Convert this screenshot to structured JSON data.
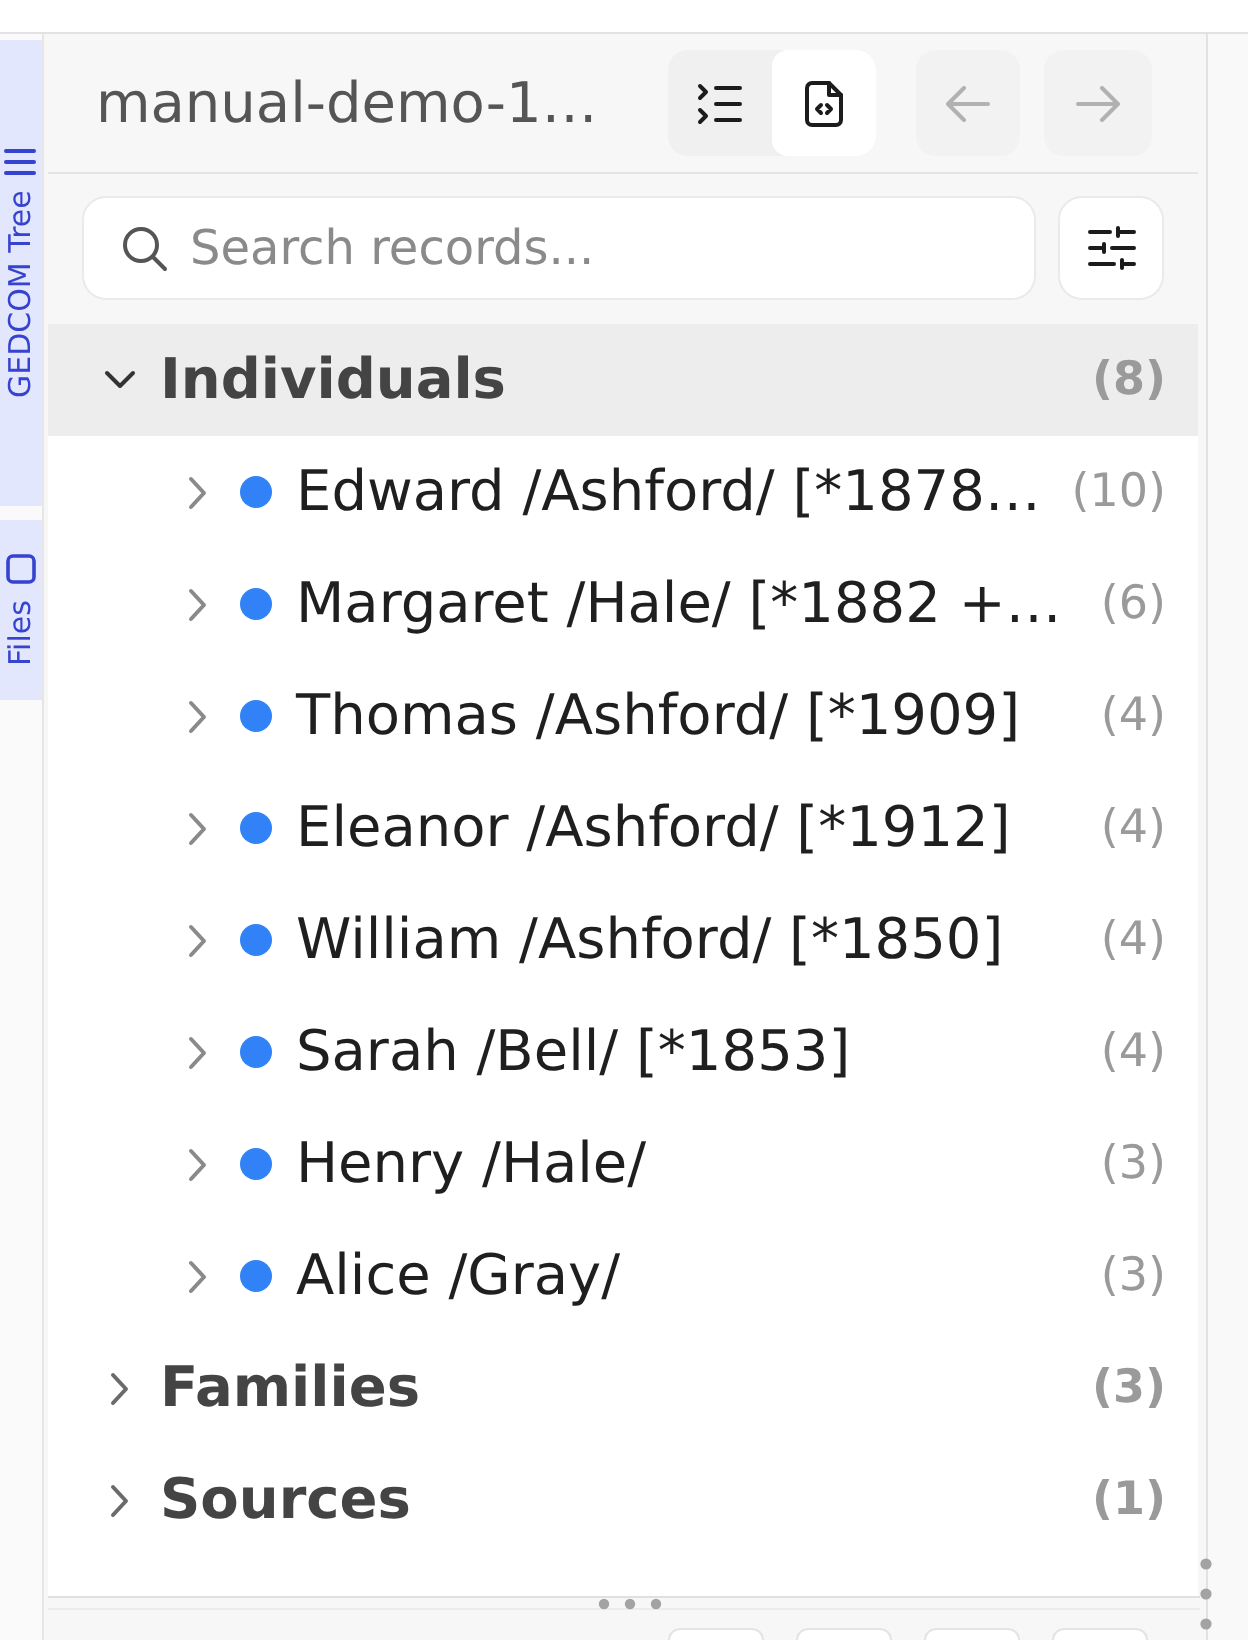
{
  "side_tabs": [
    {
      "kind": "tree",
      "label": "GEDCOM Tree"
    },
    {
      "kind": "files",
      "label": "Files"
    }
  ],
  "header": {
    "title": "manual-demo-1…",
    "view_toggle": [
      {
        "kind": "outline",
        "selected": false
      },
      {
        "kind": "source",
        "selected": true
      }
    ],
    "nav_buttons": [
      {
        "kind": "back",
        "disabled": true
      },
      {
        "kind": "forward",
        "disabled": true
      }
    ]
  },
  "search": {
    "placeholder": "Search records..."
  },
  "tree": [
    {
      "label": "Individuals",
      "count": "(8)",
      "expanded": true,
      "selected": true,
      "children": [
        {
          "label": "Edward /Ashford/ [*1878…",
          "count": "(10)",
          "expanded": false,
          "selected": false
        },
        {
          "label": "Margaret /Hale/ [*1882 +…",
          "count": "(6)",
          "expanded": false,
          "selected": false
        },
        {
          "label": "Thomas /Ashford/ [*1909]",
          "count": "(4)",
          "expanded": false,
          "selected": false
        },
        {
          "label": "Eleanor /Ashford/ [*1912]",
          "count": "(4)",
          "expanded": false,
          "selected": false
        },
        {
          "label": "William /Ashford/ [*1850]",
          "count": "(4)",
          "expanded": false,
          "selected": false
        },
        {
          "label": "Sarah /Bell/ [*1853]",
          "count": "(4)",
          "expanded": false,
          "selected": false
        },
        {
          "label": "Henry /Hale/",
          "count": "(3)",
          "expanded": false,
          "selected": false
        },
        {
          "label": "Alice /Gray/",
          "count": "(3)",
          "expanded": false,
          "selected": false
        }
      ]
    },
    {
      "label": "Families",
      "count": "(3)",
      "expanded": false,
      "selected": false
    },
    {
      "label": "Sources",
      "count": "(1)",
      "expanded": false,
      "selected": false
    }
  ]
}
